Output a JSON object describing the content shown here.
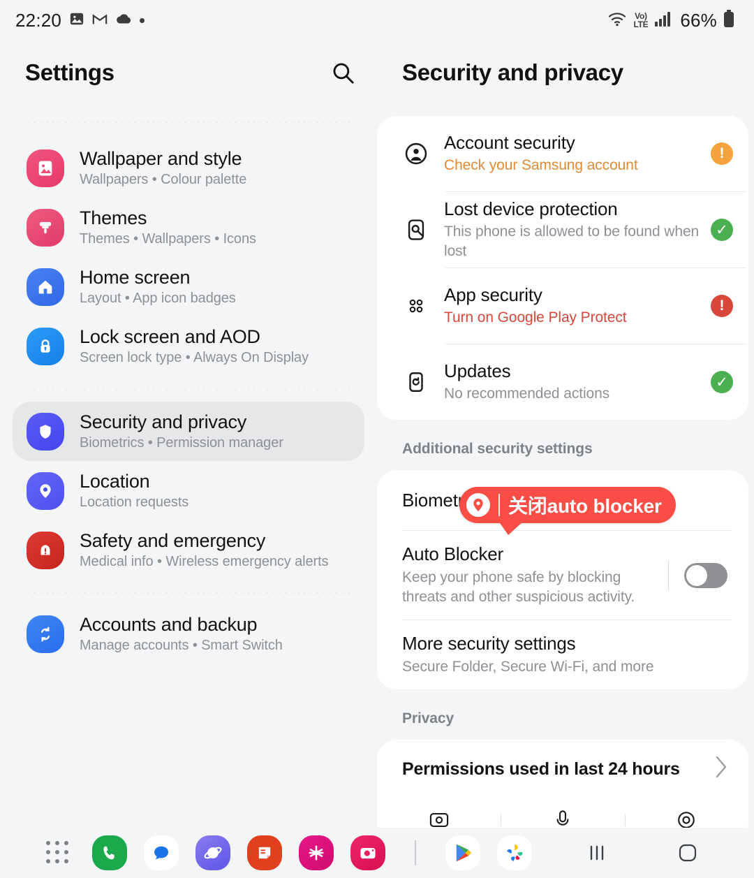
{
  "status_bar": {
    "clock": "22:20",
    "battery_percent": "66%",
    "network_label_top": "Vo)",
    "network_label_bottom": "LTE",
    "icons": [
      "image-icon",
      "gmail-icon",
      "cloud-icon",
      "dot-icon",
      "wifi-icon",
      "volte-icon",
      "signal-icon",
      "battery-icon"
    ]
  },
  "left_panel": {
    "title": "Settings",
    "search_icon": "search-icon",
    "items": [
      {
        "title": "Wallpaper and style",
        "subtitle": "Wallpapers  •  Colour palette",
        "icon": "wallpaper-icon",
        "color": "#ef4e79",
        "selected": false
      },
      {
        "title": "Themes",
        "subtitle": "Themes  •  Wallpapers  •  Icons",
        "icon": "brush-icon",
        "color": "#ea4b6e",
        "selected": false
      },
      {
        "title": "Home screen",
        "subtitle": "Layout  •  App icon badges",
        "icon": "home-icon",
        "color": "#3a76f0",
        "selected": false
      },
      {
        "title": "Lock screen and AOD",
        "subtitle": "Screen lock type  •  Always On Display",
        "icon": "lock-icon",
        "color": "#1e8ff0",
        "selected": false
      },
      {
        "title": "Security and privacy",
        "subtitle": "Biometrics  •  Permission manager",
        "icon": "shield-icon",
        "color": "#4b4df0",
        "selected": true
      },
      {
        "title": "Location",
        "subtitle": "Location requests",
        "icon": "location-pin-icon",
        "color": "#5356f2",
        "selected": false
      },
      {
        "title": "Safety and emergency",
        "subtitle": "Medical info  •  Wireless emergency alerts",
        "icon": "emergency-icon",
        "color": "#d32f2f",
        "selected": false
      },
      {
        "title": "Accounts and backup",
        "subtitle": "Manage accounts  •  Smart Switch",
        "icon": "sync-icon",
        "color": "#2f7cf0",
        "selected": false
      }
    ]
  },
  "right_panel": {
    "title": "Security and privacy",
    "security_card": [
      {
        "title": "Account security",
        "subtitle": "Check your Samsung account",
        "subtitle_style": "warn",
        "icon": "account-circle-icon",
        "badge": "orange",
        "badge_glyph": "!"
      },
      {
        "title": "Lost device protection",
        "subtitle": "This phone is allowed to be found when lost",
        "subtitle_style": "muted",
        "icon": "find-device-icon",
        "badge": "green",
        "badge_glyph": "✓"
      },
      {
        "title": "App security",
        "subtitle": "Turn on Google Play Protect",
        "subtitle_style": "danger",
        "icon": "apps-grid-icon",
        "badge": "red",
        "badge_glyph": "!"
      },
      {
        "title": "Updates",
        "subtitle": "No recommended actions",
        "subtitle_style": "muted",
        "icon": "update-icon",
        "badge": "green",
        "badge_glyph": "✓"
      }
    ],
    "additional_label": "Additional security settings",
    "biometrics_row": {
      "title": "Biometrics"
    },
    "auto_blocker": {
      "title": "Auto Blocker",
      "subtitle": "Keep your phone safe by blocking threats and other suspicious activity.",
      "toggle_state": "off"
    },
    "more_security": {
      "title": "More security settings",
      "subtitle": "Secure Folder, Secure Wi-Fi, and more"
    },
    "privacy_label": "Privacy",
    "permissions": {
      "title": "Permissions used in last 24 hours",
      "chevron": "chevron-right-icon",
      "icons": [
        "camera-icon",
        "microphone-icon",
        "location-icon"
      ]
    }
  },
  "callout": {
    "text": "关闭auto  blocker",
    "icon": "location-pin-icon",
    "color": "#fa4d45"
  },
  "taskbar": {
    "apps_grid_icon": "apps-grid-icon",
    "apps": [
      {
        "name": "phone-app-icon",
        "color": "#1ba94c"
      },
      {
        "name": "messages-app-icon",
        "color": "#ffffff"
      },
      {
        "name": "internet-app-icon",
        "color": "#6a66e8"
      },
      {
        "name": "notes-app-icon",
        "color": "#e1401f"
      },
      {
        "name": "gallery-app-icon",
        "color": "#e0117a"
      },
      {
        "name": "camera-app-icon",
        "color": "#e8215a"
      },
      {
        "name": "play-store-app-icon",
        "color": "#ffffff"
      },
      {
        "name": "galaxy-store-app-icon",
        "color": "#ffffff"
      }
    ],
    "nav": [
      {
        "name": "recents-button",
        "glyph": "|||"
      },
      {
        "name": "home-button",
        "glyph": "□"
      },
      {
        "name": "back-button",
        "glyph": "‹"
      }
    ]
  }
}
